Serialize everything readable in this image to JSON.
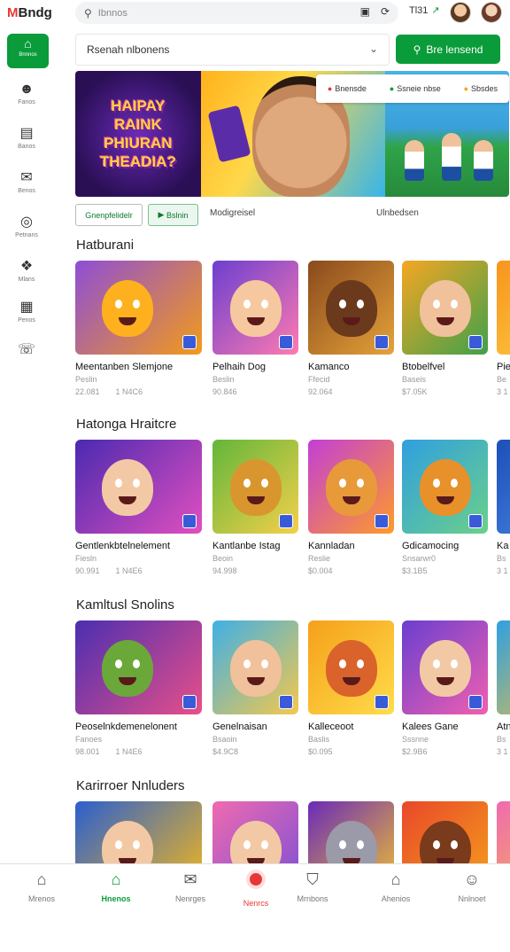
{
  "app": {
    "logo_text": "Bndg",
    "logo_mark": "M"
  },
  "search": {
    "placeholder": "Ibnnos"
  },
  "top_right": {
    "status_text": "Tl31",
    "status_arrow": "↗"
  },
  "sidebar": {
    "home_label": "Bnnnos",
    "items": [
      {
        "icon": "profile-icon",
        "label": "Fanos"
      },
      {
        "icon": "list-icon",
        "label": "Banos"
      },
      {
        "icon": "chat-icon",
        "label": "Benos"
      },
      {
        "icon": "target-icon",
        "label": "Petnans"
      },
      {
        "icon": "puzzle-icon",
        "label": "Mlans"
      },
      {
        "icon": "calendar-icon",
        "label": "Penos"
      },
      {
        "icon": "support-icon",
        "label": ""
      }
    ]
  },
  "filter": {
    "value": "Rsenah nlbonens",
    "action_label": "Bre lensend"
  },
  "banner": {
    "left_title": [
      "HAIPAY",
      "RAINK",
      "PHIURAN",
      "THEADIA?"
    ],
    "tags": [
      {
        "label": "Bnensde"
      },
      {
        "label": "Ssneie nbse"
      },
      {
        "label": "Sbsdes"
      }
    ]
  },
  "chips": {
    "chip1": "Gnenpfelidelr",
    "chip2": "Bslnin",
    "text1": "Modigreisel",
    "text2": "Ulnbedsen"
  },
  "sections": [
    {
      "title": "Hatburani",
      "cards": [
        {
          "title": "Meentanben Slemjone",
          "sub": "Peslin",
          "rating": "22.081",
          "size": "1 N4C6",
          "colors": [
            "#8e4ed6",
            "#f39a1a"
          ],
          "char": "#ffb01e"
        },
        {
          "title": "Pelhaih Dog",
          "sub": "Beslin",
          "rating": "90.846",
          "size": "",
          "colors": [
            "#6b3fd0",
            "#ff7ab0"
          ],
          "char": "#f6c8a0"
        },
        {
          "title": "Kamanco",
          "sub": "Ffecid",
          "rating": "92.064",
          "size": "",
          "colors": [
            "#8a4a1c",
            "#e5a23a"
          ],
          "char": "#6b3a1c"
        },
        {
          "title": "Btobelfvel",
          "sub": "Baseis",
          "rating": "$7.05K",
          "size": "",
          "colors": [
            "#f5a623",
            "#3fa14a"
          ],
          "char": "#f0c19b"
        },
        {
          "title": "Pie",
          "sub": "Be",
          "rating": "3 1",
          "size": "",
          "colors": [
            "#f7941d",
            "#ffd24a"
          ],
          "char": "#ffffff"
        }
      ]
    },
    {
      "title": "Hatonga Hraitcre",
      "cards": [
        {
          "title": "Gentlenkbtelnelement",
          "sub": "Fiesln",
          "rating": "90.991",
          "size": "1 N4E6",
          "colors": [
            "#4b2ab0",
            "#e04fc0"
          ],
          "char": "#f2c9a4"
        },
        {
          "title": "Kantlanbe Istag",
          "sub": "Beoin",
          "rating": "94.998",
          "size": "",
          "colors": [
            "#62b63a",
            "#f4d04a"
          ],
          "char": "#d9962e"
        },
        {
          "title": "Kannladan",
          "sub": "Reslie",
          "rating": "$0.004",
          "size": "",
          "colors": [
            "#c23fd6",
            "#ff9a2a"
          ],
          "char": "#e89a3a"
        },
        {
          "title": "Gdicamocing",
          "sub": "Snsarwr0",
          "rating": "$3.1B5",
          "size": "",
          "colors": [
            "#2f9fe0",
            "#6bd08a"
          ],
          "char": "#e8902a"
        },
        {
          "title": "Ka",
          "sub": "Bs",
          "rating": "3 1",
          "size": "",
          "colors": [
            "#1d4fb8",
            "#4a8ae6"
          ],
          "char": "#ffffff"
        }
      ]
    },
    {
      "title": "Kamltusl Snolins",
      "cards": [
        {
          "title": "Peoselnkdemenelonent",
          "sub": "Fanoes",
          "rating": "98.001",
          "size": "1 N4E6",
          "colors": [
            "#4a2fb0",
            "#e84f8a"
          ],
          "char": "#6aa83a"
        },
        {
          "title": "Genelnaisan",
          "sub": "Bsaoin",
          "rating": "$4.9C8",
          "size": "",
          "colors": [
            "#3fb0e6",
            "#f5c84a"
          ],
          "char": "#f0c19b"
        },
        {
          "title": "Kalleceoot",
          "sub": "Baslis",
          "rating": "$0.095",
          "size": "",
          "colors": [
            "#f5a01a",
            "#ffdc4a"
          ],
          "char": "#d9632a"
        },
        {
          "title": "Kalees Gane",
          "sub": "Sssnne",
          "rating": "$2.9B6",
          "size": "",
          "colors": [
            "#6a3fd0",
            "#f05fb0"
          ],
          "char": "#f2c9a4"
        },
        {
          "title": "Atn",
          "sub": "Bs",
          "rating": "3 1",
          "size": "",
          "colors": [
            "#2fa0e0",
            "#f0c040"
          ],
          "char": "#ffffff"
        }
      ]
    },
    {
      "title": "Karirroer Nnluders",
      "cards": [
        {
          "title": "",
          "sub": "",
          "rating": "",
          "size": "",
          "colors": [
            "#2a5fd0",
            "#f5b81a"
          ],
          "char": "#f2c9a4"
        },
        {
          "title": "",
          "sub": "",
          "rating": "",
          "size": "",
          "colors": [
            "#f06ab0",
            "#7a4fd6"
          ],
          "char": "#f2c9a4"
        },
        {
          "title": "",
          "sub": "",
          "rating": "",
          "size": "",
          "colors": [
            "#6a2bb8",
            "#f0c030"
          ],
          "char": "#9a9aa8"
        },
        {
          "title": "",
          "sub": "",
          "rating": "",
          "size": "",
          "colors": [
            "#e8482a",
            "#f5a01a"
          ],
          "char": "#7a3a1c"
        },
        {
          "title": "",
          "sub": "",
          "rating": "",
          "size": "",
          "colors": [
            "#f06ab0",
            "#f5c040"
          ],
          "char": "#ffffff"
        }
      ]
    }
  ],
  "bottom_nav": [
    {
      "icon": "home-icon",
      "label": "Mrenos"
    },
    {
      "icon": "store-icon",
      "label": "Hnenos",
      "active": true
    },
    {
      "icon": "chat-icon",
      "label": "Nenrges"
    },
    {
      "icon": "record-icon",
      "label": "Nenrcs",
      "accent": true
    },
    {
      "icon": "shield-icon",
      "label": "Mrnbons"
    },
    {
      "icon": "bell-icon",
      "label": "Ahenios"
    },
    {
      "icon": "profile-icon",
      "label": "Nnlnoet"
    }
  ],
  "colors": {
    "accent": "#0a9b3a",
    "record": "#e53935"
  }
}
